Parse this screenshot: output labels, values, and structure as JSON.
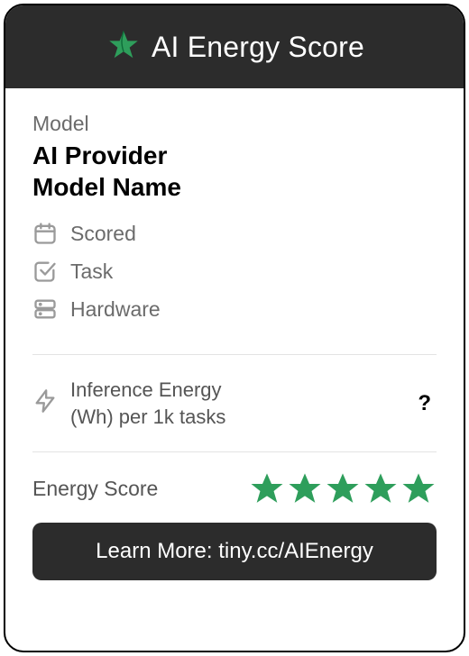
{
  "header": {
    "title": "AI Energy Score"
  },
  "model": {
    "label": "Model",
    "provider": "AI Provider",
    "name": "Model Name"
  },
  "meta": {
    "scored_label": "Scored",
    "task_label": "Task",
    "hardware_label": "Hardware"
  },
  "inference": {
    "label_line1": "Inference Energy",
    "label_line2": "(Wh) per 1k tasks",
    "value": "?"
  },
  "score": {
    "label": "Energy Score",
    "stars": 5
  },
  "learn_more": {
    "label": "Learn More: tiny.cc/AIEnergy"
  },
  "colors": {
    "accent_green": "#2e9e5b",
    "header_bg": "#2c2c2c",
    "muted_text": "#6b6b6b"
  }
}
